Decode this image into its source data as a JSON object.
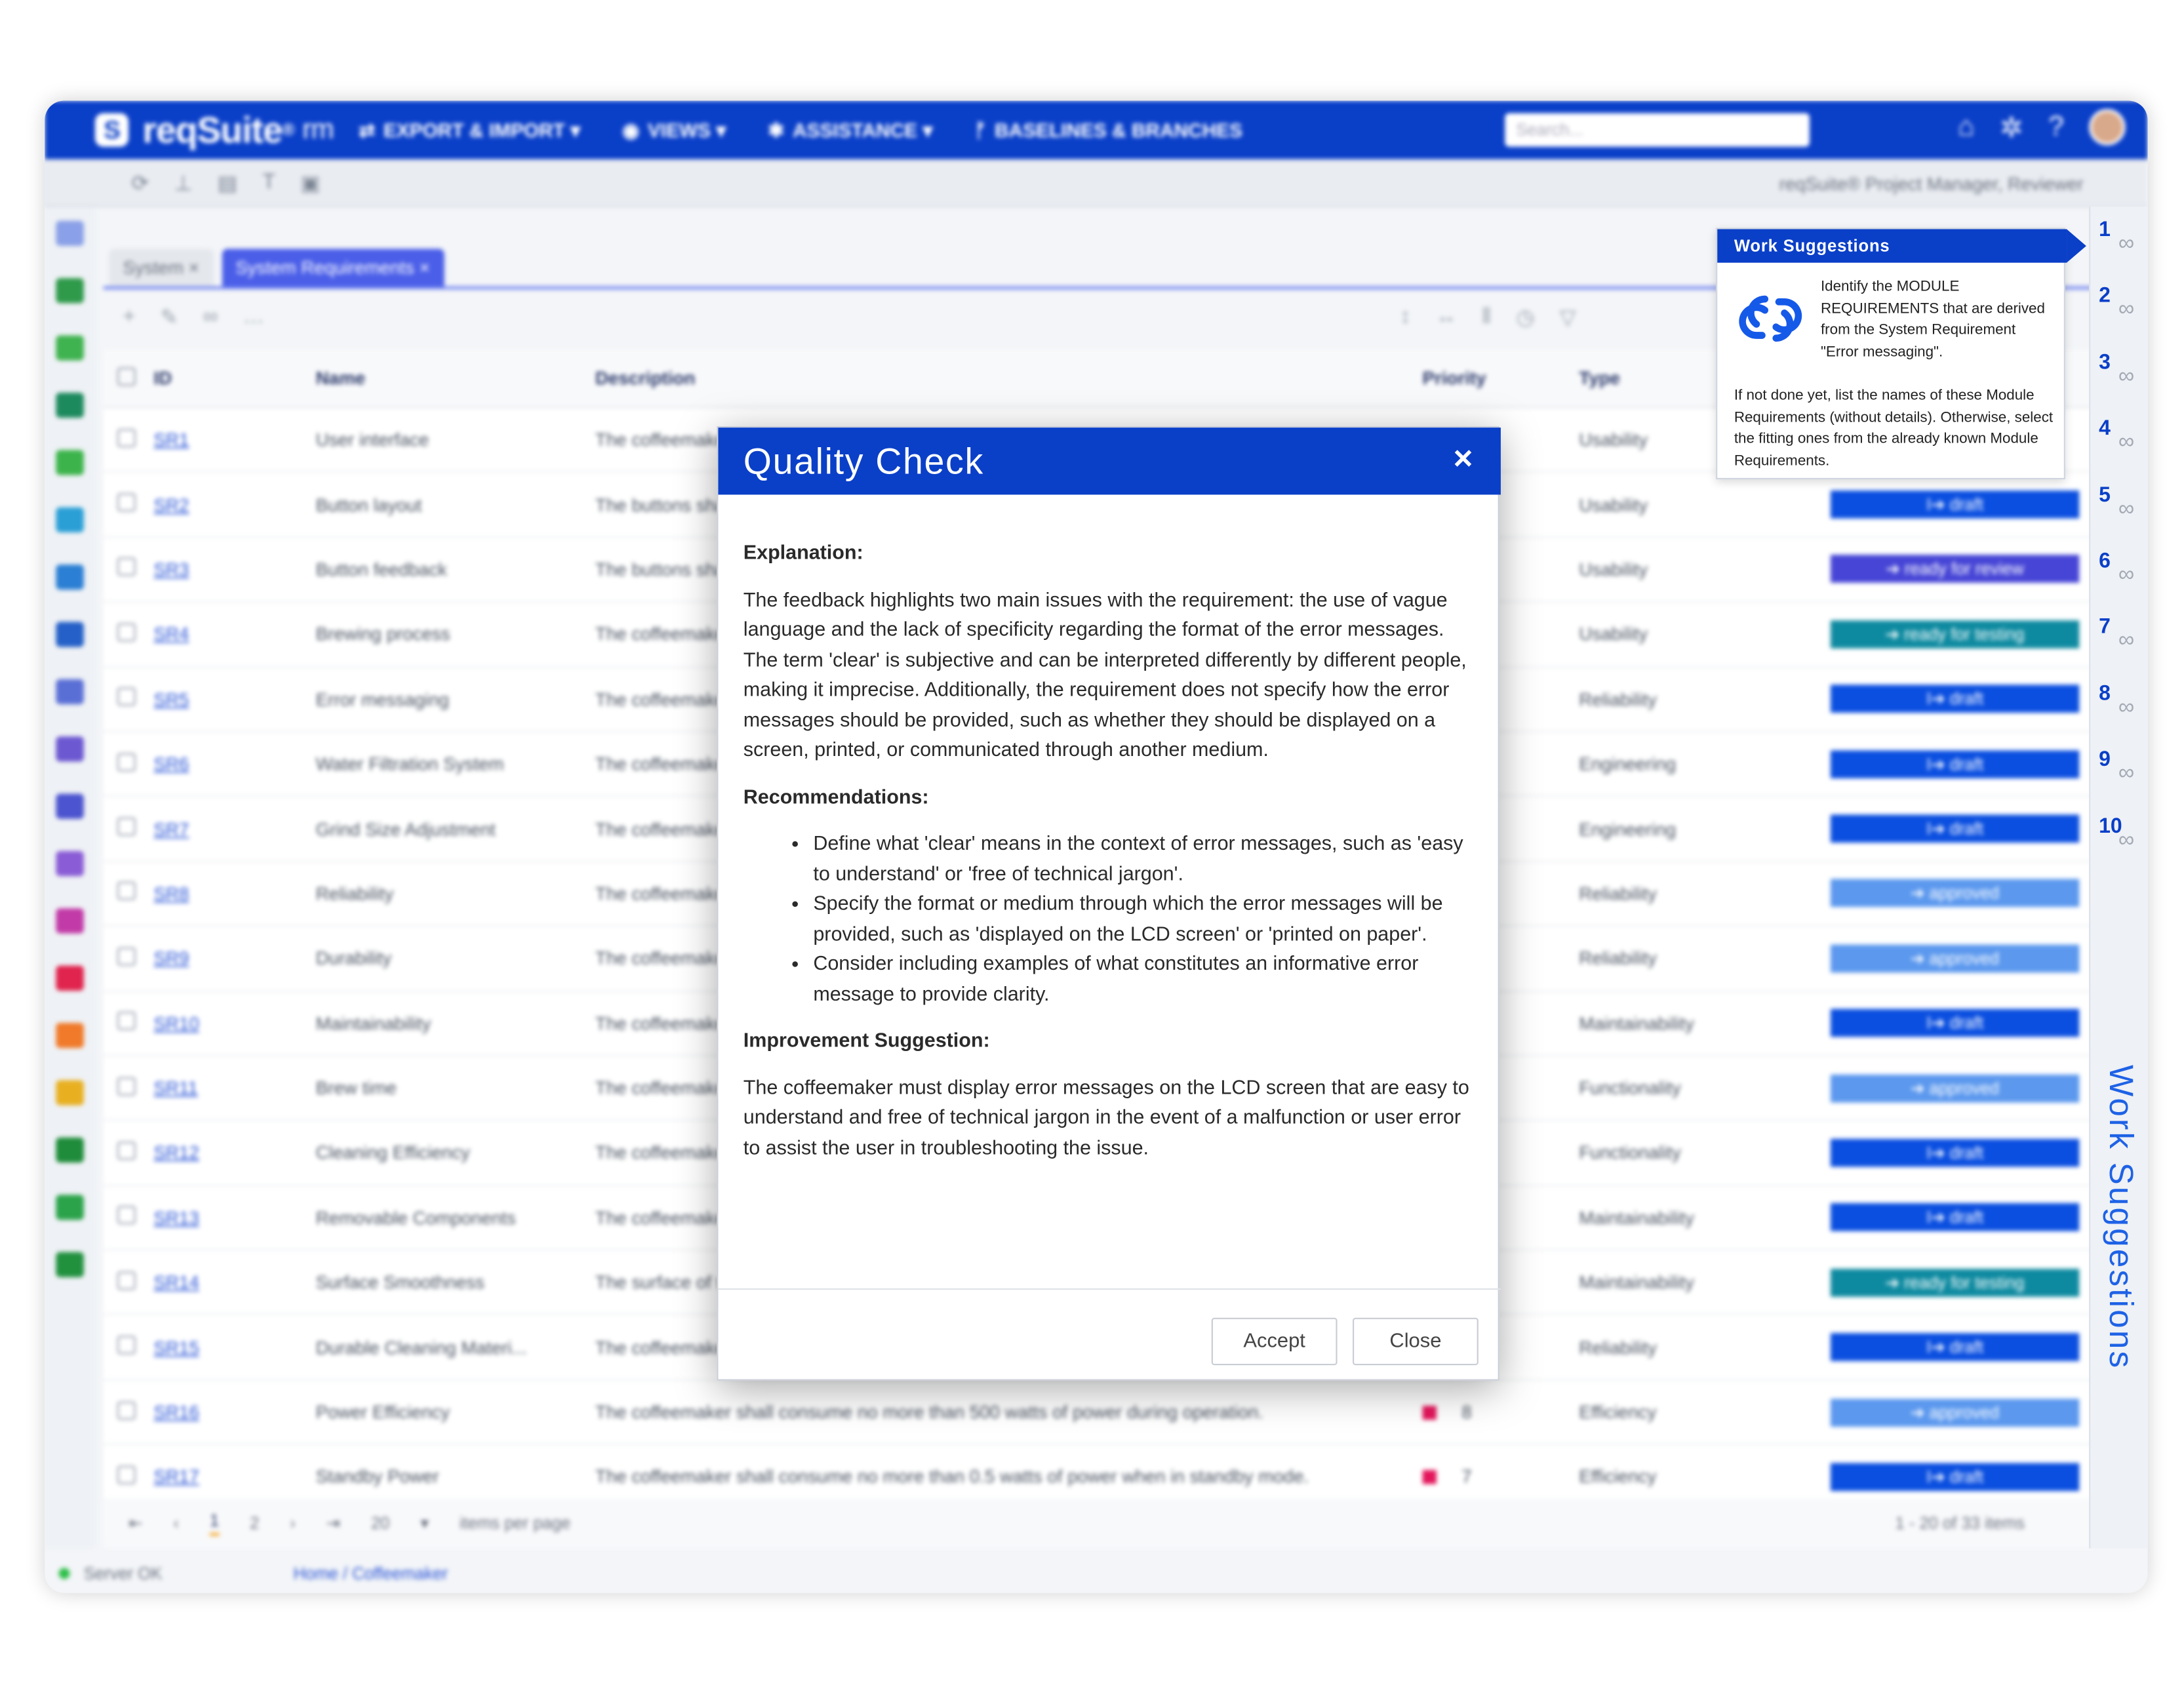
{
  "app": {
    "logo_text": "reqSuite",
    "logo_sup": "®",
    "logo_suffix": "rm",
    "menu": [
      {
        "label": "EXPORT & IMPORT ▾",
        "icon": "swap-icon"
      },
      {
        "label": "VIEWS ▾",
        "icon": "eye-icon"
      },
      {
        "label": "ASSISTANCE ▾",
        "icon": "magic-wand-icon"
      },
      {
        "label": "BASELINES & BRANCHES",
        "icon": "branch-icon"
      }
    ],
    "search_placeholder": "Search...",
    "role": "reqSuite® Project Manager, Reviewer"
  },
  "tabs": [
    {
      "label": "System ×"
    },
    {
      "label": "System Requirements ×"
    }
  ],
  "grid": {
    "columns": {
      "id": "ID",
      "name": "Name",
      "description": "Description",
      "priority": "Priority",
      "type": "Type"
    },
    "rows": [
      {
        "id": "SR1",
        "name": "User interface",
        "desc": "The coffeemaker shall provide an intuitive user interface.",
        "priority": "",
        "type": "Usability",
        "status": "",
        "status_class": ""
      },
      {
        "id": "SR2",
        "name": "Button layout",
        "desc": "The buttons shall be arranged logically.",
        "priority": "",
        "type": "Usability",
        "status": "I➔ draft",
        "status_class": "st-draft"
      },
      {
        "id": "SR3",
        "name": "Button feedback",
        "desc": "The buttons shall give feedback when pressed.",
        "priority": "",
        "type": "Usability",
        "status": "➔ ready for review",
        "status_class": "st-review"
      },
      {
        "id": "SR4",
        "name": "Brewing process",
        "desc": "The coffeemaker shall brew coffee automatically.",
        "priority": "",
        "type": "Usability",
        "status": "➔ ready for testing",
        "status_class": "st-testing"
      },
      {
        "id": "SR5",
        "name": "Error messaging",
        "desc": "The coffeemaker shall display clear error messages.",
        "priority": "",
        "type": "Reliability",
        "status": "I➔ draft",
        "status_class": "st-draft"
      },
      {
        "id": "SR6",
        "name": "Water Filtration System",
        "desc": "The coffeemaker shall filter the water before brewing.",
        "priority": "",
        "type": "Engineering",
        "status": "I➔ draft",
        "status_class": "st-draft"
      },
      {
        "id": "SR7",
        "name": "Grind Size Adjustment",
        "desc": "The coffeemaker shall allow grind size adjustment.",
        "priority": "",
        "type": "Engineering",
        "status": "I➔ draft",
        "status_class": "st-draft"
      },
      {
        "id": "SR8",
        "name": "Reliability",
        "desc": "The coffeemaker shall operate reliably.",
        "priority": "",
        "type": "Reliability",
        "status": "➔ approved",
        "status_class": "st-approved"
      },
      {
        "id": "SR9",
        "name": "Durability",
        "desc": "The coffeemaker shall be durable.",
        "priority": "",
        "type": "Reliability",
        "status": "➔ approved",
        "status_class": "st-approved"
      },
      {
        "id": "SR10",
        "name": "Maintainability",
        "desc": "The coffeemaker shall be easy to maintain.",
        "priority": "",
        "type": "Maintainability",
        "status": "I➔ draft",
        "status_class": "st-draft"
      },
      {
        "id": "SR11",
        "name": "Brew time",
        "desc": "The coffeemaker shall brew within a short time.",
        "priority": "",
        "type": "Functionality",
        "status": "➔ approved",
        "status_class": "st-approved"
      },
      {
        "id": "SR12",
        "name": "Cleaning Efficiency",
        "desc": "The coffeemaker shall be efficient to clean.",
        "priority": "",
        "type": "Functionality",
        "status": "I➔ draft",
        "status_class": "st-draft"
      },
      {
        "id": "SR13",
        "name": "Removable Components",
        "desc": "The coffeemaker shall have removable components.",
        "priority": "",
        "type": "Maintainability",
        "status": "I➔ draft",
        "status_class": "st-draft"
      },
      {
        "id": "SR14",
        "name": "Surface Smoothness",
        "desc": "The surface of the coffeemaker shall be smooth.",
        "priority": "",
        "type": "Maintainability",
        "status": "➔ ready for testing",
        "status_class": "st-testing"
      },
      {
        "id": "SR15",
        "name": "Durable Cleaning Materi...",
        "desc": "The coffeemaker shall use durable cleaning materials.",
        "priority": "",
        "type": "Reliability",
        "status": "I➔ draft",
        "status_class": "st-draft"
      },
      {
        "id": "SR16",
        "name": "Power Efficiency",
        "desc": "The coffeemaker shall consume no more than 500 watts of power during operation.",
        "priority": "8",
        "type": "Efficiency",
        "status": "➔ approved",
        "status_class": "st-approved"
      },
      {
        "id": "SR17",
        "name": "Standby Power",
        "desc": "The coffeemaker shall consume no more than 0.5 watts of power when in standby mode.",
        "priority": "7",
        "type": "Efficiency",
        "status": "I➔ draft",
        "status_class": "st-draft"
      }
    ]
  },
  "pager": {
    "pages": [
      "1",
      "2"
    ],
    "page_size": "20",
    "items_per_page": "items per page",
    "count": "1 - 20 of 33 items"
  },
  "statusbar": {
    "server": "Server OK",
    "breadcrumb": "Home / Coffeemaker"
  },
  "work_suggestions": {
    "title": "Work Suggestions",
    "numbers": [
      "1",
      "2",
      "3",
      "4",
      "5",
      "6",
      "7",
      "8",
      "9",
      "10"
    ],
    "vertical_label": "Work Suggestions",
    "text1": "Identify the MODULE REQUIREMENTS that are derived from the System Requirement \"Error messaging\".",
    "text2": "If not done yet, list the names of these Module Requirements (without details). Otherwise, select the fitting ones from the already known Module Requirements.",
    "icon": "link-icon"
  },
  "modal": {
    "title": "Quality Check",
    "close_symbol": "×",
    "explanation_label": "Explanation:",
    "explanation": "The feedback highlights two main issues with the requirement: the use of vague language and the lack of specificity regarding the format of the error messages. The term 'clear' is subjective and can be interpreted differently by different people, making it imprecise. Additionally, the requirement does not specify how the error messages should be provided, such as whether they should be displayed on a screen, printed, or communicated through another medium.",
    "recommendations_label": "Recommendations:",
    "recommendations": [
      "Define what 'clear' means in the context of error messages, such as 'easy to understand' or 'free of technical jargon'.",
      "Specify the format or medium through which the error messages will be provided, such as 'displayed on the LCD screen' or 'printed on paper'.",
      "Consider including examples of what constitutes an informative error message to provide clarity."
    ],
    "improvement_label": "Improvement Suggestion:",
    "improvement": "The coffeemaker must display error messages on the LCD screen that are easy to understand and free of technical jargon in the event of a malfunction or user error to assist the user in troubleshooting the issue.",
    "accept_label": "Accept",
    "close_label": "Close"
  },
  "colors": {
    "brand": "#0a3fc8",
    "draft": "#0b4fe0",
    "approved": "#5b98ee",
    "testing": "#0e8aa0",
    "review": "#4645d6"
  }
}
